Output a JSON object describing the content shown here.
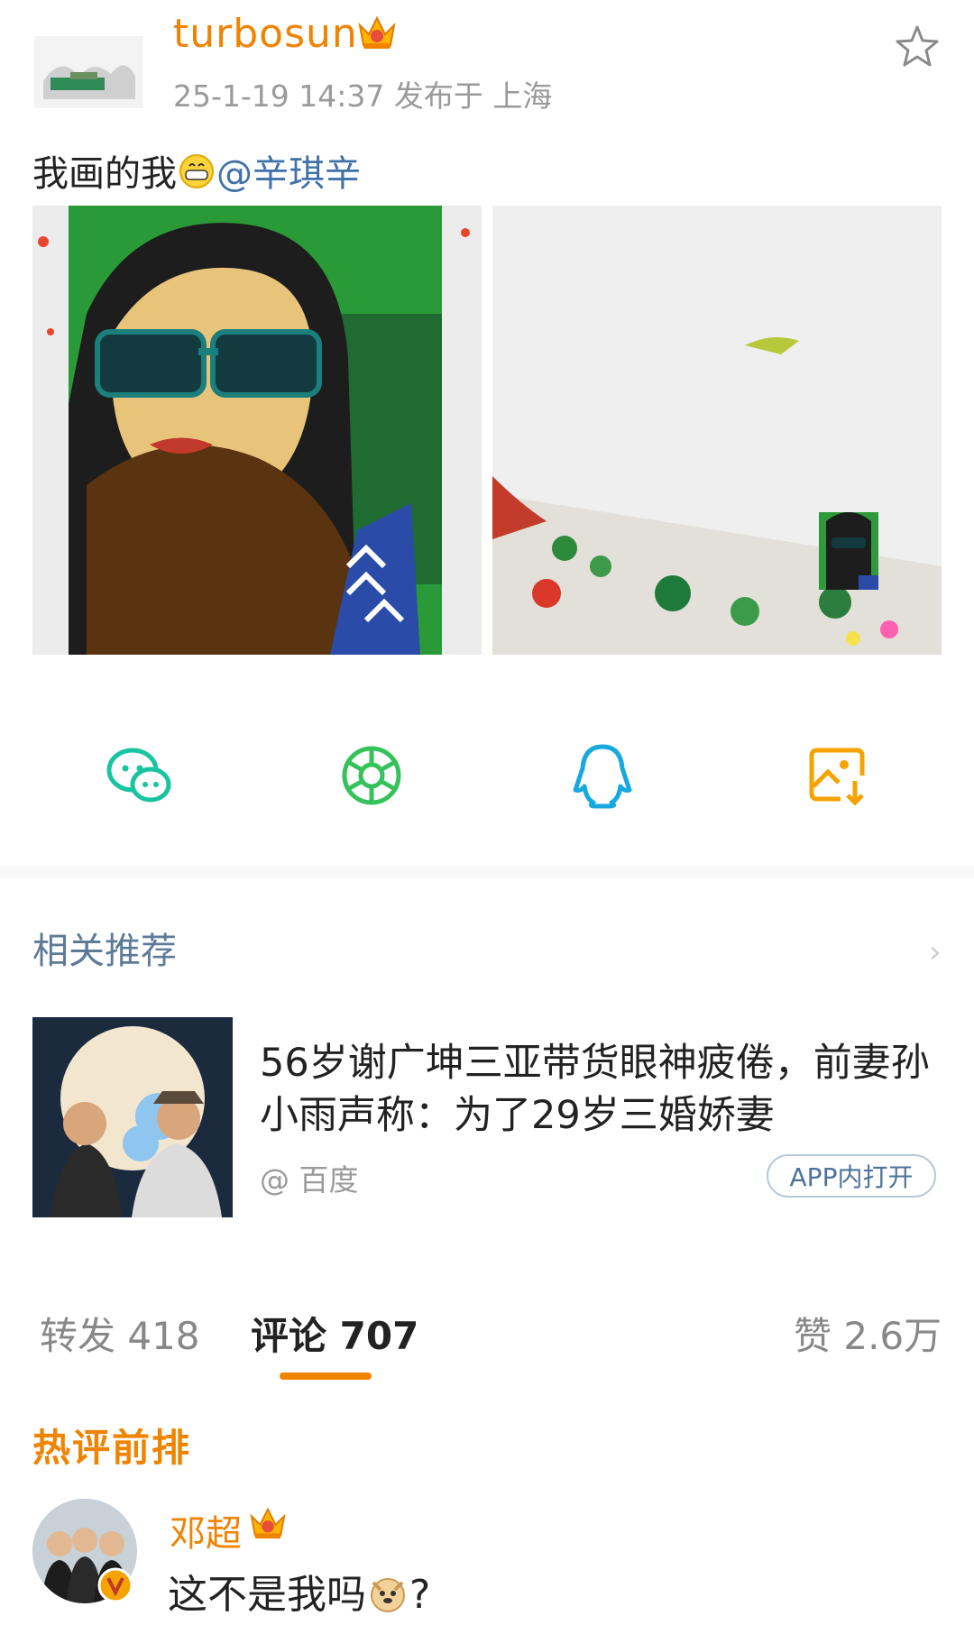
{
  "post": {
    "username": "turbosun",
    "meta": "25-1-19 14:37  发布于 上海",
    "text_before": "我画的我",
    "mention": "@辛琪辛"
  },
  "share": [
    "wechat-icon",
    "moments-icon",
    "qq-icon",
    "save-image-icon"
  ],
  "related": {
    "title": "相关推荐",
    "headline": "56岁谢广坤三亚带货眼神疲倦，前妻孙小雨声称：为了29岁三婚娇妻",
    "source": "@ 百度",
    "open_button": "APP内打开"
  },
  "tabs": {
    "repost": "转发 418",
    "comments": "评论 707",
    "likes": "赞 2.6万"
  },
  "hot_comments": {
    "title": "热评前排",
    "items": [
      {
        "user": "邓超",
        "text_before": "这不是我吗",
        "text_after": "?"
      }
    ]
  },
  "colors": {
    "accent": "#f08300",
    "link": "#3f72a8",
    "muted": "#9a9a9a"
  }
}
